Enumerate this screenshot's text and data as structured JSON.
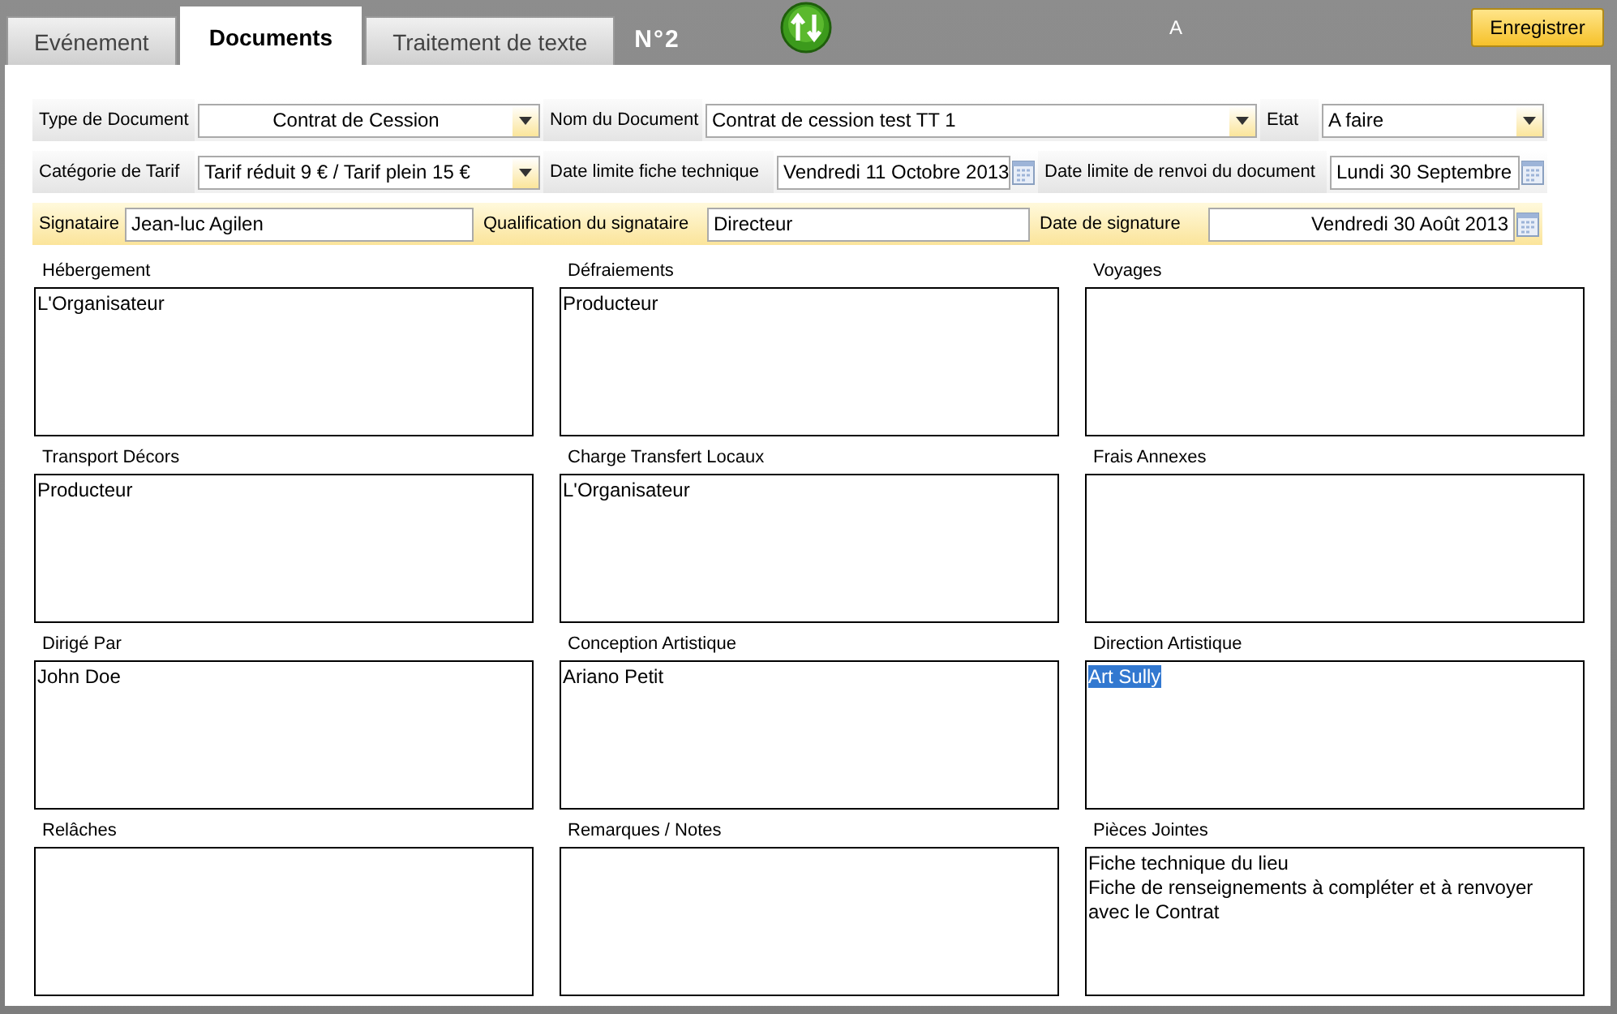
{
  "tabs": [
    {
      "label": "Evénement",
      "selected": false
    },
    {
      "label": "Documents",
      "selected": true
    },
    {
      "label": "Traitement de texte",
      "selected": false
    }
  ],
  "record_number": "N°2",
  "top_letter": "A",
  "save_button": "Enregistrer",
  "form_rows": [
    {
      "fields": [
        {
          "label": "Type de Document",
          "kind": "select",
          "value": "Contrat de Cession",
          "highlight": false
        },
        {
          "label": "Nom du Document",
          "kind": "select",
          "value": "Contrat de cession test TT 1",
          "highlight": false
        },
        {
          "label": "Etat",
          "kind": "select",
          "value": "A faire",
          "highlight": false
        }
      ]
    },
    {
      "fields": [
        {
          "label": "Catégorie de Tarif",
          "kind": "select",
          "value": "Tarif réduit 9 € / Tarif plein 15 €",
          "highlight": false
        },
        {
          "label": "Date limite fiche technique",
          "kind": "date",
          "value": "Vendredi 11 Octobre 2013",
          "highlight": false
        },
        {
          "label": "Date limite de renvoi du document",
          "kind": "date",
          "value": "Lundi 30 Septembre",
          "highlight": false
        }
      ]
    },
    {
      "fields": [
        {
          "label": "Signataire",
          "kind": "text",
          "value": "Jean-luc Agilen",
          "highlight": true
        },
        {
          "label": "Qualification du signataire",
          "kind": "text",
          "value": "Directeur",
          "highlight": true
        },
        {
          "label": "Date de signature",
          "kind": "date",
          "value": "Vendredi 30 Août 2013",
          "highlight": true
        }
      ]
    }
  ],
  "notes": [
    {
      "label": "Hébergement",
      "text": "L'Organisateur"
    },
    {
      "label": "Défraiements",
      "text": "Producteur"
    },
    {
      "label": "Voyages"
    },
    {
      "label": "Transport Décors",
      "text": "Producteur"
    },
    {
      "label": "Charge Transfert Locaux",
      "text": "L'Organisateur"
    },
    {
      "label": "Frais Annexes"
    },
    {
      "label": "Dirigé Par",
      "text": "John Doe"
    },
    {
      "label": "Conception Artistique",
      "text": "Ariano Petit"
    },
    {
      "label": "Direction Artistique",
      "text": "Art Sully",
      "text_selected": true
    },
    {
      "label": "Relâches"
    },
    {
      "label": "Remarques / Notes"
    },
    {
      "label": "Pièces Jointes",
      "text": "Fiche technique du lieu\nFiche de renseignements à compléter et à renvoyer avec le Contrat"
    }
  ]
}
